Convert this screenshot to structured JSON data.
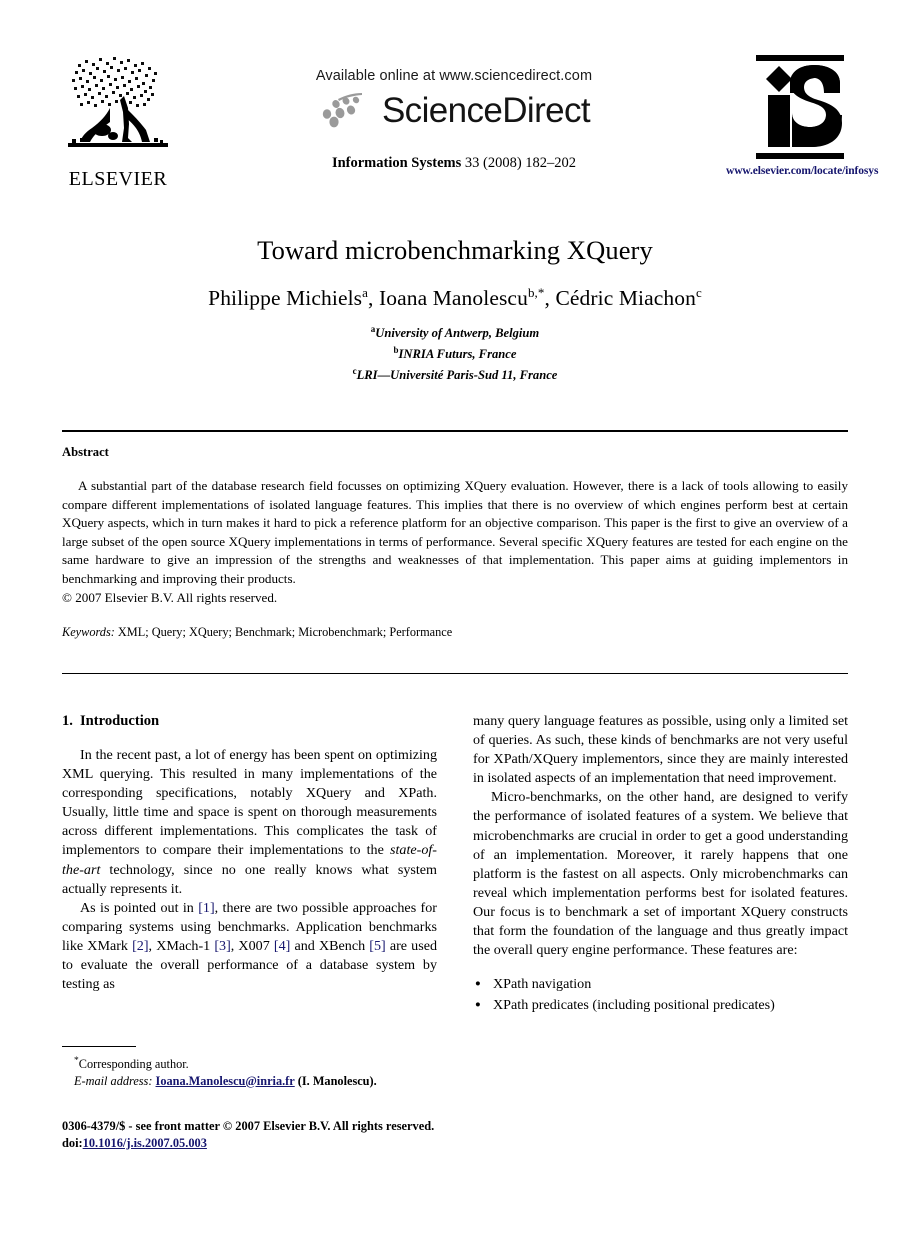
{
  "masthead": {
    "publisher_logo_name": "ELSEVIER",
    "available_online": "Available online at www.sciencedirect.com",
    "sciencedirect_wordmark": "ScienceDirect",
    "journal_ref_name": "Information Systems",
    "journal_ref_detail": "33 (2008) 182–202",
    "journal_site_url": "www.elsevier.com/locate/infosys",
    "journal_logo_letters": "iS"
  },
  "title_block": {
    "title": "Toward microbenchmarking XQuery",
    "authors": [
      {
        "name": "Philippe Michiels",
        "marks": "a",
        "sep": ", "
      },
      {
        "name": "Ioana Manolescu",
        "marks": "b,*",
        "sep": ", "
      },
      {
        "name": "Cédric Miachon",
        "marks": "c",
        "sep": ""
      }
    ],
    "affiliations": [
      {
        "mark": "a",
        "text": "University of Antwerp, Belgium"
      },
      {
        "mark": "b",
        "text": "INRIA Futurs, France"
      },
      {
        "mark": "c",
        "text": "LRI—Université Paris-Sud 11, France"
      }
    ]
  },
  "abstract": {
    "heading": "Abstract",
    "text": "A substantial part of the database research field focusses on optimizing XQuery evaluation. However, there is a lack of tools allowing to easily compare different implementations of isolated language features. This implies that there is no overview of which engines perform best at certain XQuery aspects, which in turn makes it hard to pick a reference platform for an objective comparison. This paper is the first to give an overview of a large subset of the open source XQuery implementations in terms of performance. Several specific XQuery features are tested for each engine on the same hardware to give an impression of the strengths and weaknesses of that implementation. This paper aims at guiding implementors in benchmarking and improving their products.",
    "copyright": "© 2007 Elsevier B.V. All rights reserved.",
    "keywords_label": "Keywords:",
    "keywords_value": "XML; Query; XQuery; Benchmark; Microbenchmark; Performance"
  },
  "body": {
    "section_number": "1.",
    "section_title": "Introduction",
    "left_paragraphs": [
      {
        "parts": [
          {
            "t": "In the recent past, a lot of energy has been spent on optimizing XML querying. This resulted in many implementations of the corresponding specifications, notably XQuery and XPath. Usually, little time and space is spent on thorough measurements across different implementations. This complicates the task of implementors to compare their implementations to the ",
            "style": "normal"
          },
          {
            "t": "state-of-the-art",
            "style": "italic"
          },
          {
            "t": " technology, since no one really knows what system actually represents it.",
            "style": "normal"
          }
        ]
      },
      {
        "parts": [
          {
            "t": "As is pointed out in ",
            "style": "normal"
          },
          {
            "t": "[1]",
            "style": "cite"
          },
          {
            "t": ", there are two possible approaches for comparing systems using benchmarks. Application benchmarks like XMark ",
            "style": "normal"
          },
          {
            "t": "[2]",
            "style": "cite"
          },
          {
            "t": ", XMach-1 ",
            "style": "normal"
          },
          {
            "t": "[3]",
            "style": "cite"
          },
          {
            "t": ", X007 ",
            "style": "normal"
          },
          {
            "t": "[4]",
            "style": "cite"
          },
          {
            "t": " and XBench ",
            "style": "normal"
          },
          {
            "t": "[5]",
            "style": "cite"
          },
          {
            "t": " are used to evaluate the overall performance of a database system by testing as",
            "style": "normal"
          }
        ]
      }
    ],
    "right_paragraphs": [
      {
        "indent": false,
        "parts": [
          {
            "t": "many query language features as possible, using only a limited set of queries. As such, these kinds of benchmarks are not very useful for XPath/XQuery implementors, since they are mainly interested in isolated aspects of an implementation that need improvement.",
            "style": "normal"
          }
        ]
      },
      {
        "indent": true,
        "parts": [
          {
            "t": "Micro-benchmarks, on the other hand, are designed to verify the performance of isolated features of a system. We believe that microbenchmarks are crucial in order to get a good understanding of an implementation. Moreover, it rarely happens that one platform is the fastest on all aspects. Only microbenchmarks can reveal which implementation performs best for isolated features. Our focus is to benchmark a set of important XQuery constructs that form the foundation of the language and thus greatly impact the overall query engine performance. These features are:",
            "style": "normal"
          }
        ]
      }
    ],
    "feature_list": [
      "XPath navigation",
      "XPath predicates (including positional predicates)"
    ]
  },
  "footnote": {
    "corresponding_mark": "*",
    "corresponding_text": "Corresponding author.",
    "email_label": "E-mail address:",
    "email_address": "Ioana.Manolescu@inria.fr",
    "email_owner": "(I. Manolescu)."
  },
  "page_footer": {
    "issn_line": "0306-4379/$ - see front matter © 2007 Elsevier B.V. All rights reserved.",
    "doi_label": "doi:",
    "doi_value": "10.1016/j.is.2007.05.003"
  },
  "colors": {
    "link": "#16166e",
    "text": "#000000",
    "background": "#ffffff"
  }
}
